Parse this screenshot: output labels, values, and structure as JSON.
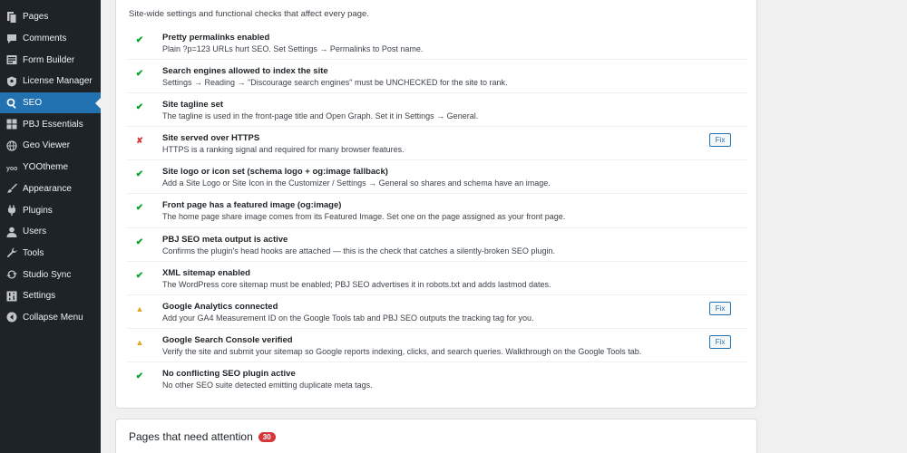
{
  "sidebar": {
    "items": [
      {
        "label": "Pages",
        "icon": "pages-icon"
      },
      {
        "label": "Comments",
        "icon": "comments-icon"
      },
      {
        "label": "Form Builder",
        "icon": "form-builder-icon"
      },
      {
        "label": "License Manager",
        "icon": "license-icon"
      },
      {
        "label": "SEO",
        "icon": "search-icon",
        "active": true
      },
      {
        "label": "PBJ Essentials",
        "icon": "grid-icon"
      },
      {
        "label": "Geo Viewer",
        "icon": "globe-icon"
      },
      {
        "label": "YOOtheme",
        "icon": "yootheme-icon"
      },
      {
        "label": "Appearance",
        "icon": "paintbrush-icon"
      },
      {
        "label": "Plugins",
        "icon": "plugin-icon"
      },
      {
        "label": "Users",
        "icon": "user-icon"
      },
      {
        "label": "Tools",
        "icon": "wrench-icon"
      },
      {
        "label": "Studio Sync",
        "icon": "sync-icon"
      },
      {
        "label": "Settings",
        "icon": "settings-icon"
      },
      {
        "label": "Collapse Menu",
        "icon": "collapse-icon"
      }
    ]
  },
  "checks_card": {
    "intro": "Site-wide settings and functional checks that affect every page.",
    "fix_label": "Fix",
    "items": [
      {
        "status": "ok",
        "symbol": "✔",
        "title": "Pretty permalinks enabled",
        "desc": "Plain ?p=123 URLs hurt SEO. Set Settings → Permalinks to Post name.",
        "fix": false
      },
      {
        "status": "ok",
        "symbol": "✔",
        "title": "Search engines allowed to index the site",
        "desc": "Settings → Reading → \"Discourage search engines\" must be UNCHECKED for the site to rank.",
        "fix": false
      },
      {
        "status": "ok",
        "symbol": "✔",
        "title": "Site tagline set",
        "desc": "The tagline is used in the front-page title and Open Graph. Set it in Settings → General.",
        "fix": false
      },
      {
        "status": "fail",
        "symbol": "✘",
        "title": "Site served over HTTPS",
        "desc": "HTTPS is a ranking signal and required for many browser features.",
        "fix": true
      },
      {
        "status": "ok",
        "symbol": "✔",
        "title": "Site logo or icon set (schema logo + og:image fallback)",
        "desc": "Add a Site Logo or Site Icon in the Customizer / Settings → General so shares and schema have an image.",
        "fix": false
      },
      {
        "status": "ok",
        "symbol": "✔",
        "title": "Front page has a featured image (og:image)",
        "desc": "The home page share image comes from its Featured Image. Set one on the page assigned as your front page.",
        "fix": false
      },
      {
        "status": "ok",
        "symbol": "✔",
        "title": "PBJ SEO meta output is active",
        "desc": "Confirms the plugin's head hooks are attached — this is the check that catches a silently-broken SEO plugin.",
        "fix": false
      },
      {
        "status": "ok",
        "symbol": "✔",
        "title": "XML sitemap enabled",
        "desc": "The WordPress core sitemap must be enabled; PBJ SEO advertises it in robots.txt and adds lastmod dates.",
        "fix": false
      },
      {
        "status": "warn",
        "symbol": "▲",
        "title": "Google Analytics connected",
        "desc": "Add your GA4 Measurement ID on the Google Tools tab and PBJ SEO outputs the tracking tag for you.",
        "fix": true
      },
      {
        "status": "warn",
        "symbol": "▲",
        "title": "Google Search Console verified",
        "desc": "Verify the site and submit your sitemap so Google reports indexing, clicks, and search queries. Walkthrough on the Google Tools tab.",
        "fix": true
      },
      {
        "status": "ok",
        "symbol": "✔",
        "title": "No conflicting SEO plugin active",
        "desc": "No other SEO suite detected emitting duplicate meta tags.",
        "fix": false
      }
    ]
  },
  "attention_card": {
    "title": "Pages that need attention",
    "count": "30"
  },
  "colors": {
    "sidebar_bg": "#1d2327",
    "active_bg": "#2271b1",
    "ok": "#00a32a",
    "fail": "#d63638",
    "warn": "#dba617"
  }
}
